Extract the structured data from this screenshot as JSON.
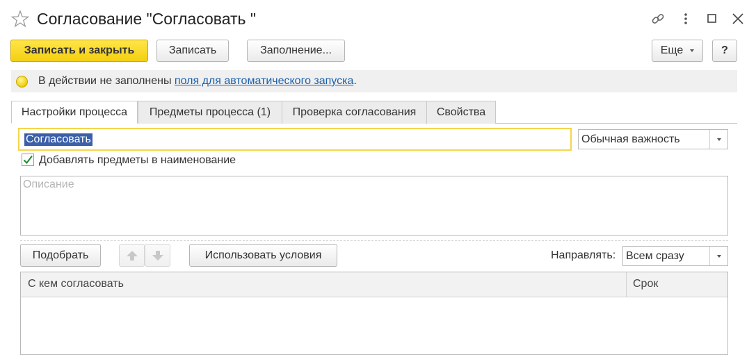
{
  "window": {
    "title": "Согласование \"Согласовать \""
  },
  "toolbar": {
    "save_close": "Записать и закрыть",
    "save": "Записать",
    "fill": "Заполнение...",
    "more": "Еще",
    "help": "?"
  },
  "infobar": {
    "text_before": "В действии не заполнены ",
    "link": "поля для автоматического запуска",
    "text_after": "."
  },
  "tabs": [
    {
      "label": "Настройки процесса",
      "active": true
    },
    {
      "label": "Предметы процесса (1)",
      "active": false
    },
    {
      "label": "Проверка согласования",
      "active": false
    },
    {
      "label": "Свойства",
      "active": false
    }
  ],
  "form": {
    "name_value": "Согласовать",
    "importance_value": "Обычная важность",
    "add_subjects_label": "Добавлять предметы в наименование",
    "add_subjects_checked": true,
    "description_placeholder": "Описание"
  },
  "table_toolbar": {
    "pick": "Подобрать",
    "use_conditions": "Использовать условия",
    "send_label": "Направлять:",
    "send_value": "Всем сразу"
  },
  "table": {
    "columns": [
      "С кем согласовать",
      "Срок"
    ]
  },
  "colors": {
    "accent_yellow": "#f4cf0f",
    "link_blue": "#1a5fa8",
    "selection_blue": "#3b5fa8"
  }
}
